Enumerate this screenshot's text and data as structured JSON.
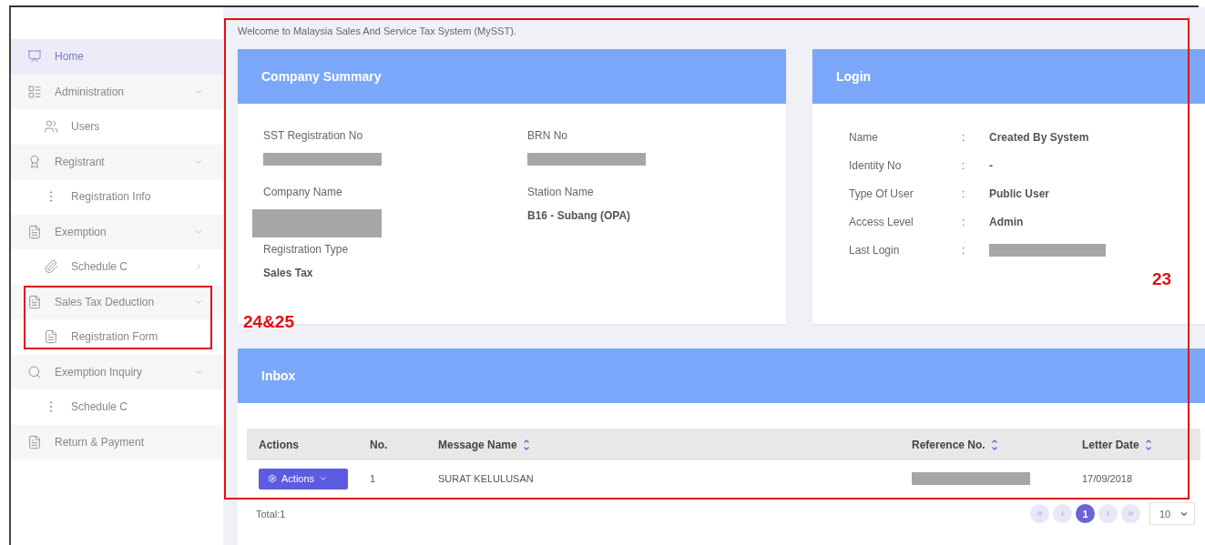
{
  "sidebar": {
    "items": [
      {
        "label": "Home",
        "selected": true
      },
      {
        "label": "Administration",
        "selected": false,
        "expanded": true,
        "children": [
          {
            "label": "Users",
            "selected": false
          }
        ]
      },
      {
        "label": "Registrant",
        "selected": false,
        "expanded": true,
        "children": [
          {
            "label": "Registration Info",
            "selected": false
          }
        ]
      },
      {
        "label": "Exemption",
        "selected": false,
        "expanded": true,
        "children": [
          {
            "label": "Schedule C",
            "selected": false,
            "expanded": false
          }
        ]
      },
      {
        "label": "Sales Tax Deduction",
        "selected": false,
        "expanded": true,
        "children": [
          {
            "label": "Registration Form",
            "selected": false
          }
        ]
      },
      {
        "label": "Exemption Inquiry",
        "selected": false,
        "expanded": true,
        "children": [
          {
            "label": "Schedule C",
            "selected": false
          }
        ]
      },
      {
        "label": "Return & Payment",
        "selected": false
      }
    ]
  },
  "welcome": "Welcome to Malaysia Sales And Service Tax System (MySST).",
  "company_summary": {
    "title": "Company Summary",
    "fields": [
      {
        "label": "SST Registration No",
        "kind": "redacted"
      },
      {
        "label": "BRN No",
        "kind": "redacted"
      },
      {
        "label": "Company Name",
        "kind": "redacted_tall"
      },
      {
        "label": "Station Name",
        "kind": "text",
        "value": "B16 - Subang (OPA)"
      },
      {
        "label": "Registration Type",
        "kind": "text",
        "value": "Sales Tax"
      }
    ]
  },
  "login": {
    "title": "Login",
    "rows": [
      {
        "label": "Name",
        "separator": ":",
        "kind": "text",
        "value": "Created By System"
      },
      {
        "label": "Identity No",
        "separator": ":",
        "kind": "text",
        "value": "-"
      },
      {
        "label": "Type Of User",
        "separator": ":",
        "kind": "text",
        "value": "Public User"
      },
      {
        "label": "Access Level",
        "separator": ":",
        "kind": "text",
        "value": "Admin"
      },
      {
        "label": "Last Login",
        "separator": ":",
        "kind": "redacted"
      }
    ]
  },
  "inbox": {
    "title": "Inbox",
    "columns": [
      {
        "label": "Actions",
        "sortable": false
      },
      {
        "label": "No.",
        "sortable": false
      },
      {
        "label": "Message Name",
        "sortable": true
      },
      {
        "label": "Reference No.",
        "sortable": true
      },
      {
        "label": "Letter Date",
        "sortable": true
      }
    ],
    "rows": [
      {
        "action": "Actions",
        "no": "1",
        "message_name": "SURAT KELULUSAN",
        "letter_date": "17/09/2018"
      }
    ],
    "total": "Total:1",
    "pages": [
      {
        "label": "1",
        "selected": true
      }
    ],
    "page_size": "10"
  },
  "annotations": [
    {
      "label": "23"
    },
    {
      "label": "24&25"
    }
  ]
}
